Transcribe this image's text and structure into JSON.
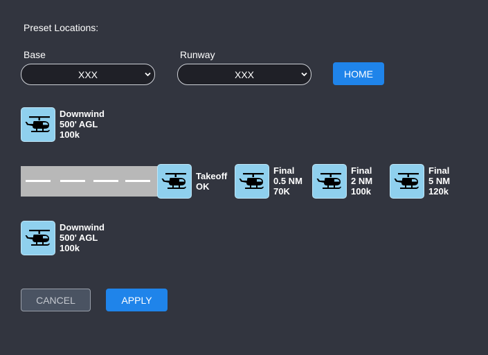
{
  "heading": "Preset Locations:",
  "base": {
    "label": "Base",
    "value": "XXX"
  },
  "runway": {
    "label": "Runway",
    "value": "XXX"
  },
  "home_label": "HOME",
  "cancel_label": "CANCEL",
  "apply_label": "APPLY",
  "icons": {
    "helicopter": "helicopter-icon",
    "dropdown": "chevron-down-icon"
  },
  "colors": {
    "accent": "#1f84ea",
    "tile": "#8fd0ee",
    "background": "#32353f",
    "runway": "#b8b8b8"
  },
  "positions": {
    "downwind_top": {
      "line1": "Downwind",
      "line2": "500' AGL",
      "line3": "100k"
    },
    "takeoff": {
      "line1": "Takeoff",
      "line2": "OK"
    },
    "final_05": {
      "line1": "Final",
      "line2": "0.5 NM",
      "line3": "70K"
    },
    "final_2": {
      "line1": "Final",
      "line2": "2 NM",
      "line3": "100k"
    },
    "final_5": {
      "line1": "Final",
      "line2": "5 NM",
      "line3": "120k"
    },
    "downwind_bottom": {
      "line1": "Downwind",
      "line2": "500' AGL",
      "line3": "100k"
    }
  }
}
